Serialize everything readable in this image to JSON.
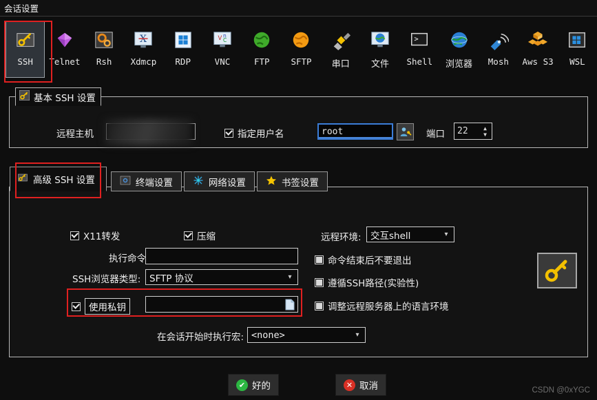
{
  "window": {
    "title": "会话设置"
  },
  "toolbar": {
    "items": [
      {
        "label": "SSH",
        "icon": "key-icon",
        "selected": true
      },
      {
        "label": "Telnet",
        "icon": "gem-icon",
        "selected": false
      },
      {
        "label": "Rsh",
        "icon": "gears-icon",
        "selected": false
      },
      {
        "label": "Xdmcp",
        "icon": "xdmcp-icon",
        "selected": false
      },
      {
        "label": "RDP",
        "icon": "windows-icon",
        "selected": false
      },
      {
        "label": "VNC",
        "icon": "vnc-icon",
        "selected": false
      },
      {
        "label": "FTP",
        "icon": "globe-green-icon",
        "selected": false
      },
      {
        "label": "SFTP",
        "icon": "globe-orange-icon",
        "selected": false
      },
      {
        "label": "串口",
        "icon": "serial-plug-icon",
        "selected": false
      },
      {
        "label": "文件",
        "icon": "file-monitor-icon",
        "selected": false
      },
      {
        "label": "Shell",
        "icon": "terminal-icon",
        "selected": false
      },
      {
        "label": "浏览器",
        "icon": "globe-blue-icon",
        "selected": false
      },
      {
        "label": "Mosh",
        "icon": "satellite-icon",
        "selected": false
      },
      {
        "label": "Aws S3",
        "icon": "aws-cubes-icon",
        "selected": false
      },
      {
        "label": "WSL",
        "icon": "wsl-icon",
        "selected": false
      }
    ]
  },
  "basic": {
    "legend": "基本 SSH 设置",
    "host_label": "远程主机",
    "host_value": "",
    "specify_user_label": "指定用户名",
    "specify_user_checked": true,
    "username_value": "root",
    "port_label": "端口",
    "port_value": "22"
  },
  "tabs": [
    {
      "label": "高级 SSH 设置",
      "icon": "key-icon",
      "active": true
    },
    {
      "label": "终端设置",
      "icon": "terminal-settings-icon",
      "active": false
    },
    {
      "label": "网络设置",
      "icon": "network-icon",
      "active": false
    },
    {
      "label": "书签设置",
      "icon": "star-icon",
      "active": false
    }
  ],
  "advanced": {
    "x11_label": "X11转发",
    "x11_checked": true,
    "compression_label": "压缩",
    "compression_checked": true,
    "exec_command_label": "执行命令:",
    "exec_command_value": "",
    "browser_type_label": "SSH浏览器类型:",
    "browser_type_value": "SFTP 协议",
    "use_private_key_label": "使用私钥",
    "use_private_key_checked": true,
    "private_key_value": "",
    "macro_label": "在会话开始时执行宏:",
    "macro_value": "<none>",
    "remote_env_label": "远程环境:",
    "remote_env_value": "交互shell",
    "no_exit_label": "命令结束后不要退出",
    "no_exit_checked": false,
    "follow_ssh_path_label": "遵循SSH路径(实验性)",
    "follow_ssh_path_checked": false,
    "adjust_locale_label": "调整远程服务器上的语言环境",
    "adjust_locale_checked": false,
    "key_button_icon": "key-icon"
  },
  "footer": {
    "ok_label": "好的",
    "cancel_label": "取消",
    "watermark": "CSDN @0xYGC"
  },
  "colors": {
    "background": "#0e0e0e",
    "accent_red": "#e02020",
    "focus_blue": "#3b7dd8",
    "ok_green": "#2cb742",
    "cancel_red": "#d93025",
    "key_yellow": "#f3c000"
  }
}
